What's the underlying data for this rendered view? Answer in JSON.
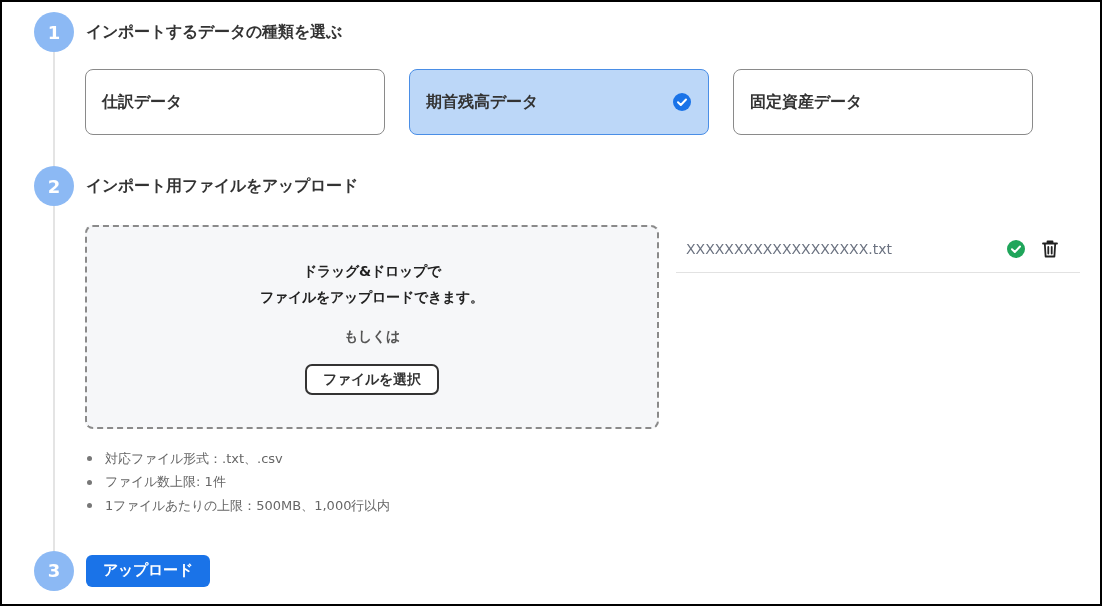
{
  "steps": [
    {
      "number": "1",
      "title": "インポートするデータの種類を選ぶ"
    },
    {
      "number": "2",
      "title": "インポート用ファイルをアップロード"
    },
    {
      "number": "3"
    }
  ],
  "data_types": [
    {
      "label": "仕訳データ",
      "selected": false
    },
    {
      "label": "期首残高データ",
      "selected": true
    },
    {
      "label": "固定資産データ",
      "selected": false
    }
  ],
  "dropzone": {
    "lines": [
      "ドラッグ&ドロップで",
      "ファイルをアップロードできます。"
    ],
    "or_text": "もしくは",
    "button": "ファイルを選択"
  },
  "uploaded_files": [
    {
      "name": "XXXXXXXXXXXXXXXXXXX.txt",
      "complete": true
    }
  ],
  "notes": [
    "対応ファイル形式：.txt、.csv",
    "ファイル数上限: 1件",
    "1ファイルあたりの上限：500MB、1,000行以内"
  ],
  "upload_button": "アップロード"
}
